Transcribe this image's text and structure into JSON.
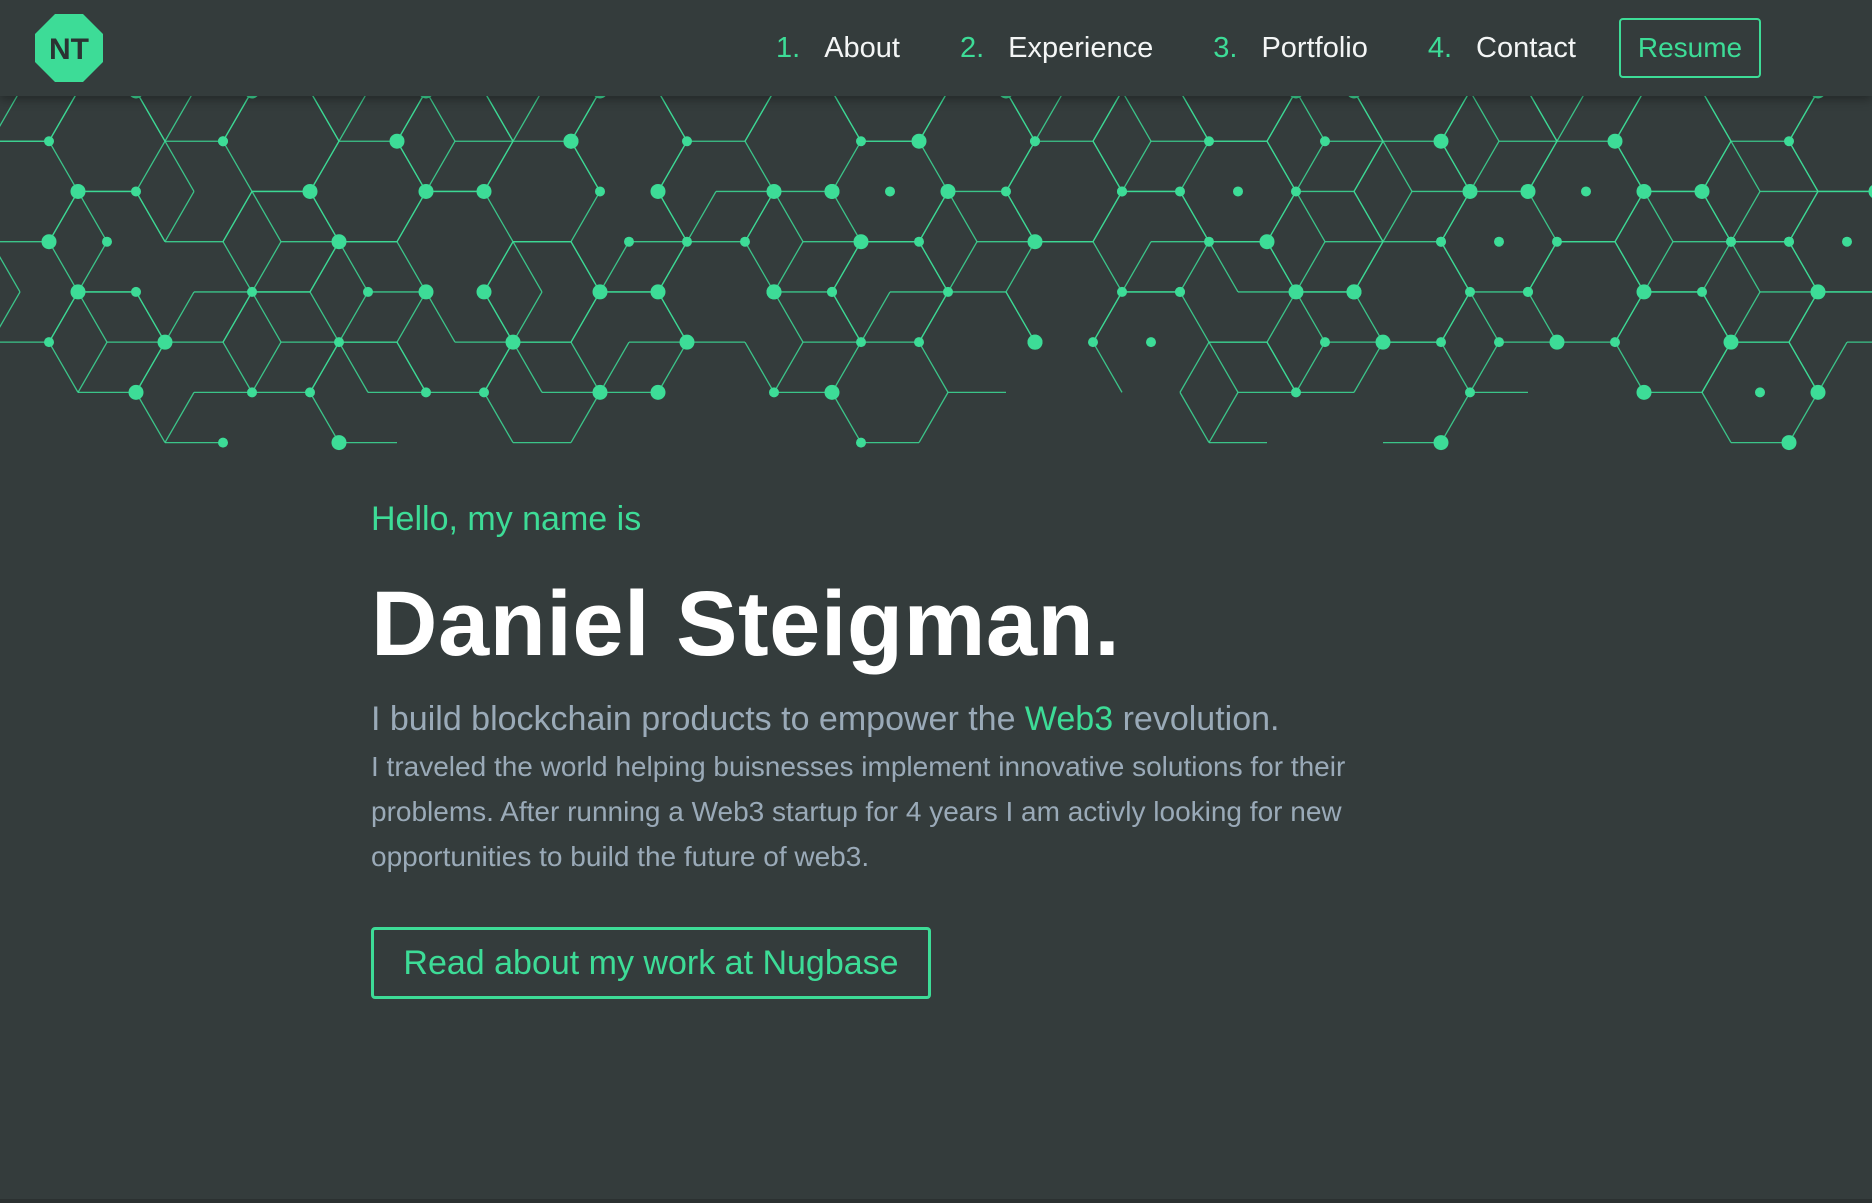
{
  "brand": {
    "logo_text": "NT",
    "logo_icon": "octagon-monogram-icon"
  },
  "nav": {
    "items": [
      {
        "num": "1.",
        "label": "About"
      },
      {
        "num": "2.",
        "label": "Experience"
      },
      {
        "num": "3.",
        "label": "Portfolio"
      },
      {
        "num": "4.",
        "label": "Contact"
      }
    ],
    "resume_label": "Resume"
  },
  "hero": {
    "greeting": "Hello, my name is",
    "name": "Daniel Steigman.",
    "tagline_before": "I build blockchain products to empower the ",
    "tagline_highlight": "Web3",
    "tagline_after": " revolution.",
    "bio": "I traveled the world helping buisnesses implement innovative solutions for their problems. After running a Web3 startup for 4 years I am activly looking for new opportunities to build the future of web3.",
    "cta_label": "Read about my work at Nugbase"
  },
  "colors": {
    "background": "#343c3c",
    "accent": "#3ddc97",
    "text_primary": "#ffffff",
    "text_secondary": "#9aaab8"
  }
}
